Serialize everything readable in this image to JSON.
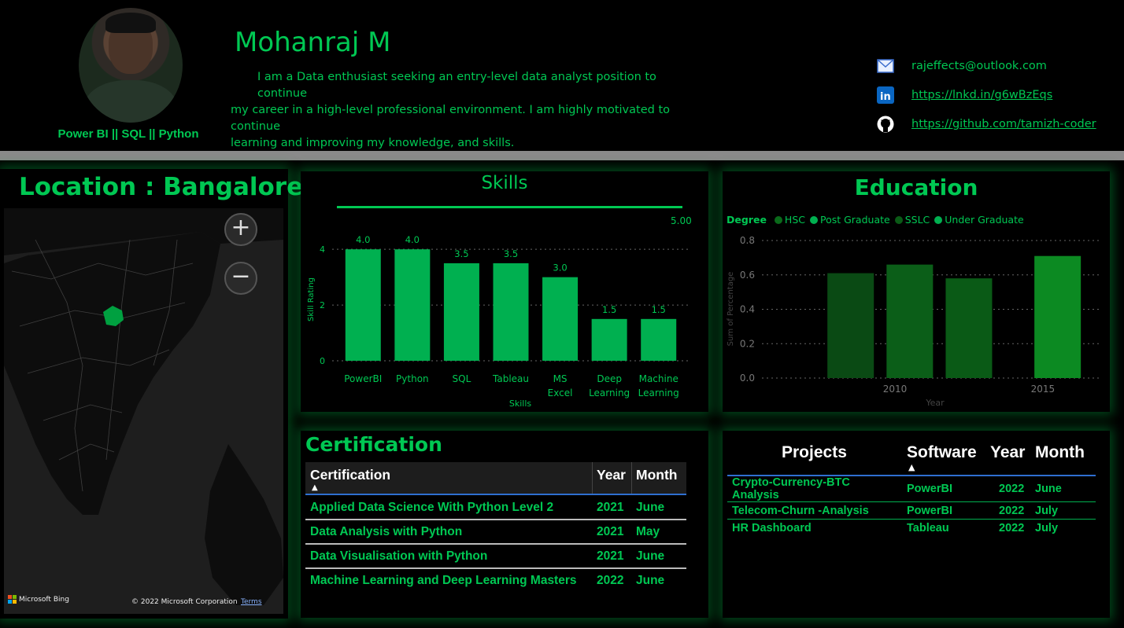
{
  "profile": {
    "name": "Mohanraj M",
    "tagline": "Power BI || SQL || Python",
    "bio_lines": [
      "I am a Data enthusiast seeking an entry-level data analyst position to continue",
      "my career in a high-level professional environment. I am highly motivated to continue",
      "learning and improving my knowledge, and skills."
    ]
  },
  "contacts": {
    "email": "rajeffects@outlook.com",
    "linkedin": "https://lnkd.in/g6wBzEqs",
    "github": "https://github.com/tamizh-coder"
  },
  "map": {
    "title": "Location : Bangalore",
    "zoom_in": "+",
    "zoom_out": "−",
    "attribution_logo": "Microsoft Bing",
    "copyright": "© 2022 Microsoft Corporation",
    "terms": "Terms"
  },
  "skills": {
    "title": "Skills",
    "max_label": "5.00"
  },
  "education": {
    "title": "Education",
    "legend_title": "Degree"
  },
  "certification": {
    "title": "Certification",
    "headers": [
      "Certification",
      "Year",
      "Month"
    ],
    "rows": [
      [
        "Applied Data Science With Python Level 2",
        "2021",
        "June"
      ],
      [
        "Data Analysis with Python",
        "2021",
        "May"
      ],
      [
        "Data Visualisation with Python",
        "2021",
        "June"
      ],
      [
        "Machine Learning and Deep Learning Masters",
        "2022",
        "June"
      ]
    ]
  },
  "projects": {
    "headers": [
      "Projects",
      "Software",
      "Year",
      "Month"
    ],
    "rows": [
      [
        "Crypto-Currency-BTC Analysis",
        "PowerBI",
        "2022",
        "June"
      ],
      [
        "Telecom-Churn -Analysis",
        "PowerBI",
        "2022",
        "July"
      ],
      [
        "HR Dashboard",
        "Tableau",
        "2022",
        "July"
      ]
    ]
  },
  "colors": {
    "accent": "#00c853",
    "bar": "#00b050",
    "hsc": "#0a4a14",
    "post_graduate": "#0b5e18",
    "sslc": "#0a5a16",
    "under_graduate": "#0c8a22"
  },
  "chart_data": [
    {
      "type": "bar",
      "title": "Skills",
      "xlabel": "Skills",
      "ylabel": "Skill Rating",
      "categories": [
        "PowerBI",
        "Python",
        "SQL",
        "Tableau",
        "MS Excel",
        "Deep Learning",
        "Machine Learning"
      ],
      "values": [
        4.0,
        4.0,
        3.5,
        3.5,
        3.0,
        1.5,
        1.5
      ],
      "data_labels": [
        "4.0",
        "4.0",
        "3.5",
        "3.5",
        "3.0",
        "1.5",
        "1.5"
      ],
      "yticks": [
        "0",
        "2",
        "4"
      ],
      "ylim": [
        0,
        4.4
      ],
      "grid": true
    },
    {
      "type": "bar",
      "title": "Education",
      "xlabel": "Year",
      "ylabel": "Sum of Percentage",
      "legend_title": "Degree",
      "legend_position": "top-left",
      "xticks": [
        "2010",
        "2015"
      ],
      "yticks": [
        "0.0",
        "0.2",
        "0.4",
        "0.6",
        "0.8"
      ],
      "ylim": [
        0,
        0.8
      ],
      "grid": true,
      "series": [
        {
          "name": "HSC",
          "x": 2008.5,
          "value": 0.61
        },
        {
          "name": "Post Graduate",
          "x": 2010.5,
          "value": 0.66
        },
        {
          "name": "SSLC",
          "x": 2012.5,
          "value": 0.58
        },
        {
          "name": "Under Graduate",
          "x": 2015.5,
          "value": 0.71
        }
      ]
    }
  ]
}
